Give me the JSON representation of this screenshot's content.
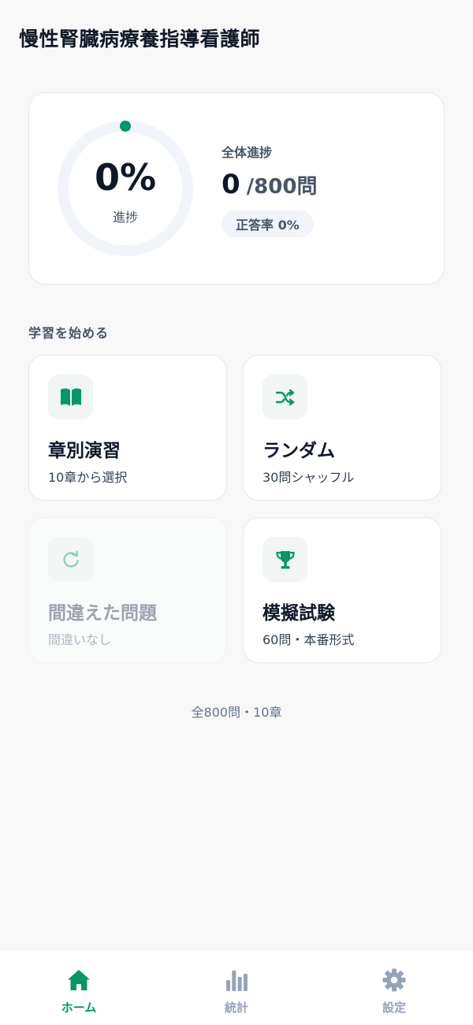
{
  "app": {
    "title": "慢性腎臓病療養指導看護師"
  },
  "progress": {
    "percent_text": "0%",
    "percent_value": 0,
    "ring_label": "進捗",
    "overall_label": "全体進捗",
    "answered": "0",
    "separator": "/",
    "total": "800問",
    "accuracy": "正答率 0%"
  },
  "section": {
    "label": "学習を始める"
  },
  "modes": [
    {
      "title": "章別演習",
      "subtitle": "10章から選択",
      "icon": "book-icon",
      "enabled": true
    },
    {
      "title": "ランダム",
      "subtitle": "30問シャッフル",
      "icon": "shuffle-icon",
      "enabled": true
    },
    {
      "title": "間違えた問題",
      "subtitle": "間違いなし",
      "icon": "retry-icon",
      "enabled": false
    },
    {
      "title": "模擬試験",
      "subtitle": "60問・本番形式",
      "icon": "trophy-icon",
      "enabled": true
    }
  ],
  "footer": {
    "summary": "全800問・10章"
  },
  "tabs": [
    {
      "label": "ホーム",
      "icon": "home-icon",
      "active": true
    },
    {
      "label": "統計",
      "icon": "bar-chart-icon",
      "active": false
    },
    {
      "label": "設定",
      "icon": "gear-icon",
      "active": false
    }
  ],
  "colors": {
    "accent": "#059669",
    "ring_track": "#f1f5f9",
    "text_primary": "#0f172a",
    "text_muted": "#475569"
  }
}
